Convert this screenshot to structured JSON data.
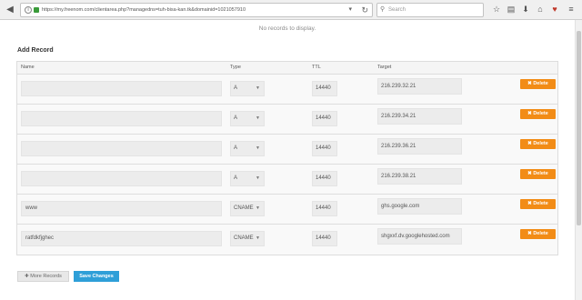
{
  "browser": {
    "url": "https://my.freenom.com/clientarea.php?managedns=tuh-bisa-kan.tk&domainid=1021057910",
    "search_placeholder": "Search"
  },
  "page": {
    "no_records": "No records to display.",
    "add_record_title": "Add Record"
  },
  "table": {
    "headers": {
      "name": "Name",
      "type": "Type",
      "ttl": "TTL",
      "target": "Target"
    },
    "rows": [
      {
        "name": "",
        "type": "A",
        "ttl": "14440",
        "target": "216.239.32.21",
        "delete": "Delete"
      },
      {
        "name": "",
        "type": "A",
        "ttl": "14440",
        "target": "216.239.34.21",
        "delete": "Delete"
      },
      {
        "name": "",
        "type": "A",
        "ttl": "14440",
        "target": "216.239.36.21",
        "delete": "Delete"
      },
      {
        "name": "",
        "type": "A",
        "ttl": "14440",
        "target": "216.239.38.21",
        "delete": "Delete"
      },
      {
        "name": "www",
        "type": "CNAME",
        "ttl": "14440",
        "target": "ghs.google.com",
        "delete": "Delete"
      },
      {
        "name": "ratfdkfjghec",
        "type": "CNAME",
        "ttl": "14440",
        "target": "shgxxf.dv.googlehosted.com",
        "delete": "Delete"
      }
    ]
  },
  "buttons": {
    "more_records": "More Records",
    "save_changes": "Save Changes"
  },
  "icons": {
    "delete_glyph": "✖",
    "more_glyph": "✚"
  },
  "colors": {
    "delete_button": "#f28c16",
    "save_button": "#2e9fd8"
  }
}
